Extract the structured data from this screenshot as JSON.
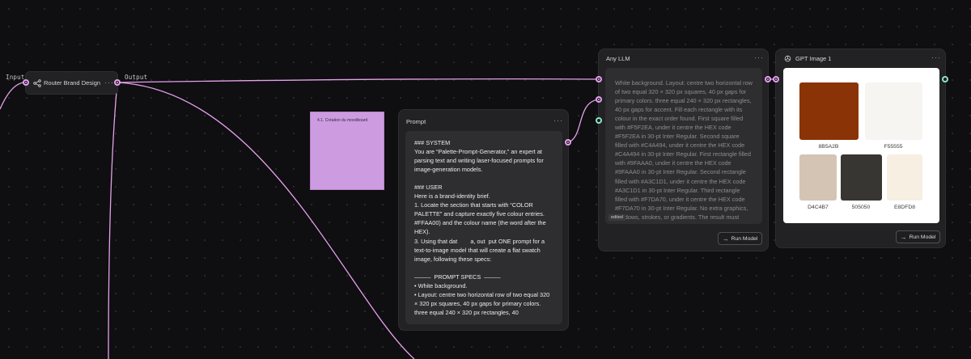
{
  "canvas": {
    "input_label": "Input",
    "output_label": "Output",
    "wire_color": "#e5a0ee"
  },
  "router_node": {
    "title": "Router Brand Design",
    "icon": "router-icon",
    "menu": "···"
  },
  "sticky_note": {
    "text": "4.1. Création du moodboard",
    "color": "#cc9be0"
  },
  "prompt_node": {
    "title": "Prompt",
    "menu": "···",
    "text": "### SYSTEM\nYou are “Palette-Prompt-Generator,” an expert at parsing text and writing laser-focused prompts for image-generation models.\n\n### USER\nHere is a brand-identity brief.\n1. Locate the section that starts with “COLOR PALETTE” and capture exactly five colour entries. #FFAA00) and the colour name (the word after the HEX).\n3. Using that dat        a, out  put ONE prompt for a text-to-image model that will create a flat swatch image, following these specs:\n\n–––––  PROMPT SPECS  –––––\n• White background.\n• Layout: centre two horizontal row of two equal 320 × 320 px squares, 40 px gaps for primary colors. three equal 240 × 320 px rectangles, 40"
  },
  "llm_node": {
    "title": "Any LLM",
    "menu": "···",
    "text": "White background. Layout: centre two horizontal row of two equal 320 × 320 px squares, 40 px gaps for primary colors. three equal 240 × 320 px rectangles, 40 px gaps for accent. Fill each rectangle with its colour in the exact order found. First square filled with #F5F2EA, under it centre the HEX code #F5F2EA in 30-pt Inter Regular. Second square filled with #C4A494, under it centre the HEX      code #C4A494 in 30-pt Inter Regular. First rectangle filled with #9FAAA0, under it centre the HEX code #9FAAA0 in 30-pt Inter Regular. Second rectangle filled with #A3C1D1, under it centre the HEX code #A3C1D1 in 30-pt Inter Regular. Third rectangle filled with #F7DA70, under it centre the HEX code #F7DA70 in 30-pt Inter Regular. No extra graphics, shadows, strokes, or gradients. The result must",
    "edited_badge": "edited",
    "run_label": "Run Model"
  },
  "image_node": {
    "title": "GPT Image 1",
    "icon": "openai-icon",
    "menu": "···",
    "run_label": "Run Model",
    "swatches": [
      {
        "label": "8B5A2B",
        "color": "#8a3306"
      },
      {
        "label": "F55555",
        "color": "#f6f5f1"
      },
      {
        "label": "D4C4B7",
        "color": "#d4c4b4"
      },
      {
        "label": "505050",
        "color": "#373633"
      },
      {
        "label": "E8DFD8",
        "color": "#f6efe2"
      }
    ]
  }
}
